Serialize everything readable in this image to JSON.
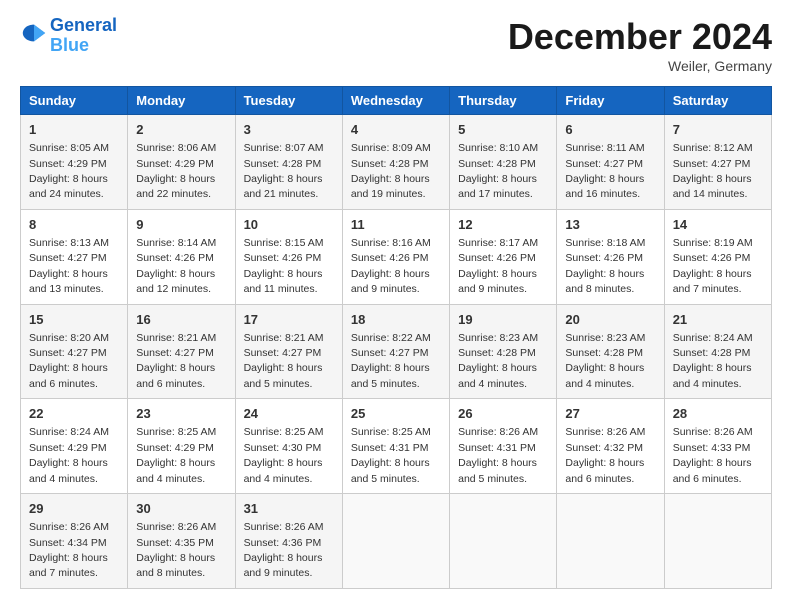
{
  "header": {
    "logo_line1": "General",
    "logo_line2": "Blue",
    "month_year": "December 2024",
    "location": "Weiler, Germany"
  },
  "weekdays": [
    "Sunday",
    "Monday",
    "Tuesday",
    "Wednesday",
    "Thursday",
    "Friday",
    "Saturday"
  ],
  "weeks": [
    [
      {
        "day": "1",
        "sunrise": "8:05 AM",
        "sunset": "4:29 PM",
        "daylight": "8 hours and 24 minutes."
      },
      {
        "day": "2",
        "sunrise": "8:06 AM",
        "sunset": "4:29 PM",
        "daylight": "8 hours and 22 minutes."
      },
      {
        "day": "3",
        "sunrise": "8:07 AM",
        "sunset": "4:28 PM",
        "daylight": "8 hours and 21 minutes."
      },
      {
        "day": "4",
        "sunrise": "8:09 AM",
        "sunset": "4:28 PM",
        "daylight": "8 hours and 19 minutes."
      },
      {
        "day": "5",
        "sunrise": "8:10 AM",
        "sunset": "4:28 PM",
        "daylight": "8 hours and 17 minutes."
      },
      {
        "day": "6",
        "sunrise": "8:11 AM",
        "sunset": "4:27 PM",
        "daylight": "8 hours and 16 minutes."
      },
      {
        "day": "7",
        "sunrise": "8:12 AM",
        "sunset": "4:27 PM",
        "daylight": "8 hours and 14 minutes."
      }
    ],
    [
      {
        "day": "8",
        "sunrise": "8:13 AM",
        "sunset": "4:27 PM",
        "daylight": "8 hours and 13 minutes."
      },
      {
        "day": "9",
        "sunrise": "8:14 AM",
        "sunset": "4:26 PM",
        "daylight": "8 hours and 12 minutes."
      },
      {
        "day": "10",
        "sunrise": "8:15 AM",
        "sunset": "4:26 PM",
        "daylight": "8 hours and 11 minutes."
      },
      {
        "day": "11",
        "sunrise": "8:16 AM",
        "sunset": "4:26 PM",
        "daylight": "8 hours and 9 minutes."
      },
      {
        "day": "12",
        "sunrise": "8:17 AM",
        "sunset": "4:26 PM",
        "daylight": "8 hours and 9 minutes."
      },
      {
        "day": "13",
        "sunrise": "8:18 AM",
        "sunset": "4:26 PM",
        "daylight": "8 hours and 8 minutes."
      },
      {
        "day": "14",
        "sunrise": "8:19 AM",
        "sunset": "4:26 PM",
        "daylight": "8 hours and 7 minutes."
      }
    ],
    [
      {
        "day": "15",
        "sunrise": "8:20 AM",
        "sunset": "4:27 PM",
        "daylight": "8 hours and 6 minutes."
      },
      {
        "day": "16",
        "sunrise": "8:21 AM",
        "sunset": "4:27 PM",
        "daylight": "8 hours and 6 minutes."
      },
      {
        "day": "17",
        "sunrise": "8:21 AM",
        "sunset": "4:27 PM",
        "daylight": "8 hours and 5 minutes."
      },
      {
        "day": "18",
        "sunrise": "8:22 AM",
        "sunset": "4:27 PM",
        "daylight": "8 hours and 5 minutes."
      },
      {
        "day": "19",
        "sunrise": "8:23 AM",
        "sunset": "4:28 PM",
        "daylight": "8 hours and 4 minutes."
      },
      {
        "day": "20",
        "sunrise": "8:23 AM",
        "sunset": "4:28 PM",
        "daylight": "8 hours and 4 minutes."
      },
      {
        "day": "21",
        "sunrise": "8:24 AM",
        "sunset": "4:28 PM",
        "daylight": "8 hours and 4 minutes."
      }
    ],
    [
      {
        "day": "22",
        "sunrise": "8:24 AM",
        "sunset": "4:29 PM",
        "daylight": "8 hours and 4 minutes."
      },
      {
        "day": "23",
        "sunrise": "8:25 AM",
        "sunset": "4:29 PM",
        "daylight": "8 hours and 4 minutes."
      },
      {
        "day": "24",
        "sunrise": "8:25 AM",
        "sunset": "4:30 PM",
        "daylight": "8 hours and 4 minutes."
      },
      {
        "day": "25",
        "sunrise": "8:25 AM",
        "sunset": "4:31 PM",
        "daylight": "8 hours and 5 minutes."
      },
      {
        "day": "26",
        "sunrise": "8:26 AM",
        "sunset": "4:31 PM",
        "daylight": "8 hours and 5 minutes."
      },
      {
        "day": "27",
        "sunrise": "8:26 AM",
        "sunset": "4:32 PM",
        "daylight": "8 hours and 6 minutes."
      },
      {
        "day": "28",
        "sunrise": "8:26 AM",
        "sunset": "4:33 PM",
        "daylight": "8 hours and 6 minutes."
      }
    ],
    [
      {
        "day": "29",
        "sunrise": "8:26 AM",
        "sunset": "4:34 PM",
        "daylight": "8 hours and 7 minutes."
      },
      {
        "day": "30",
        "sunrise": "8:26 AM",
        "sunset": "4:35 PM",
        "daylight": "8 hours and 8 minutes."
      },
      {
        "day": "31",
        "sunrise": "8:26 AM",
        "sunset": "4:36 PM",
        "daylight": "8 hours and 9 minutes."
      },
      null,
      null,
      null,
      null
    ]
  ],
  "labels": {
    "sunrise": "Sunrise:",
    "sunset": "Sunset:",
    "daylight": "Daylight:"
  }
}
